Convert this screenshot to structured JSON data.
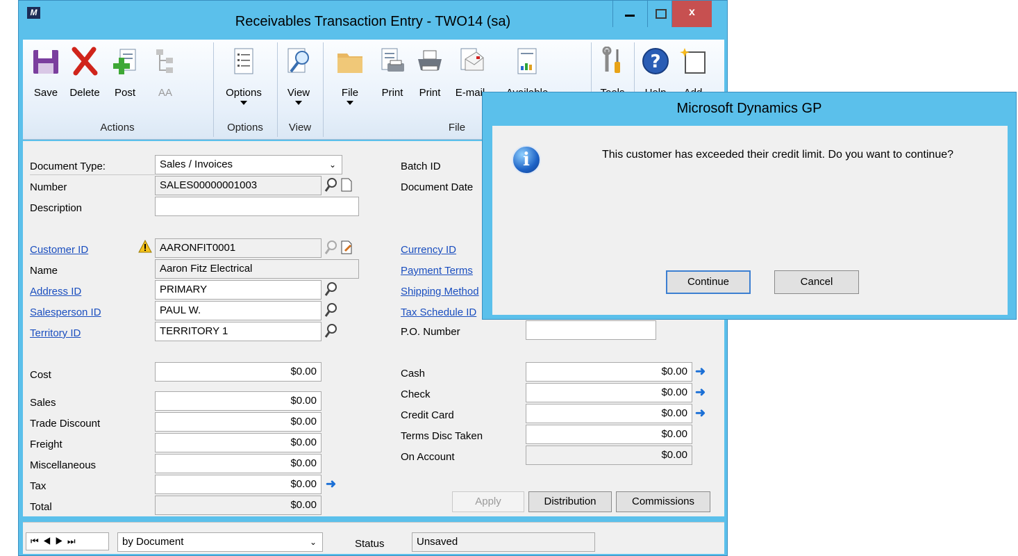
{
  "window": {
    "title": "Receivables Transaction Entry  -  TWO14 (sa)",
    "close_glyph": "x"
  },
  "ribbon": {
    "buttons": {
      "save": "Save",
      "delete": "Delete",
      "post": "Post",
      "aa": "AA",
      "options": "Options",
      "view": "View",
      "file": "File",
      "print1": "Print",
      "print2": "Print",
      "email": "E-mail",
      "available": "Available",
      "tools": "Tools",
      "help": "Help",
      "add": "Add"
    },
    "groups": {
      "actions": "Actions",
      "options": "Options",
      "view": "View",
      "file": "File"
    }
  },
  "form": {
    "document_type_label": "Document Type:",
    "document_type_value": "Sales / Invoices",
    "number_label": "Number",
    "number_value": "SALES00000001003",
    "description_label": "Description",
    "description_value": "",
    "customer_id_label": "Customer ID",
    "customer_id_value": "AARONFIT0001",
    "name_label": "Name",
    "name_value": "Aaron Fitz Electrical",
    "address_id_label": "Address ID",
    "address_id_value": "PRIMARY",
    "salesperson_id_label": "Salesperson ID",
    "salesperson_id_value": "PAUL W.",
    "territory_id_label": "Territory ID",
    "territory_id_value": "TERRITORY 1",
    "batch_id_label": "Batch ID",
    "document_date_label": "Document Date",
    "currency_id_label": "Currency ID",
    "payment_terms_label": "Payment Terms",
    "shipping_method_label": "Shipping Method",
    "tax_schedule_id_label": "Tax Schedule ID",
    "po_number_label": "P.O. Number",
    "po_number_value": "",
    "cost_label": "Cost",
    "cost_value": "$0.00",
    "sales_label": "Sales",
    "sales_value": "$0.00",
    "trade_discount_label": "Trade Discount",
    "trade_discount_value": "$0.00",
    "freight_label": "Freight",
    "freight_value": "$0.00",
    "misc_label": "Miscellaneous",
    "misc_value": "$0.00",
    "tax_label": "Tax",
    "tax_value": "$0.00",
    "total_label": "Total",
    "total_value": "$0.00",
    "cash_label": "Cash",
    "cash_value": "$0.00",
    "check_label": "Check",
    "check_value": "$0.00",
    "credit_card_label": "Credit Card",
    "credit_card_value": "$0.00",
    "terms_disc_label": "Terms Disc Taken",
    "terms_disc_value": "$0.00",
    "on_account_label": "On Account",
    "on_account_value": "$0.00",
    "apply_button": "Apply",
    "distribution_button": "Distribution",
    "commissions_button": "Commissions"
  },
  "statusbar": {
    "sort_value": "by Document",
    "status_label": "Status",
    "status_value": "Unsaved"
  },
  "dialog": {
    "title": "Microsoft Dynamics GP",
    "message": "This customer has exceeded their credit limit. Do you want to continue?",
    "continue_button": "Continue",
    "cancel_button": "Cancel"
  },
  "colors": {
    "titlebar": "#5bc0eb",
    "close_button": "#c75050",
    "link": "#1a4ebf"
  }
}
